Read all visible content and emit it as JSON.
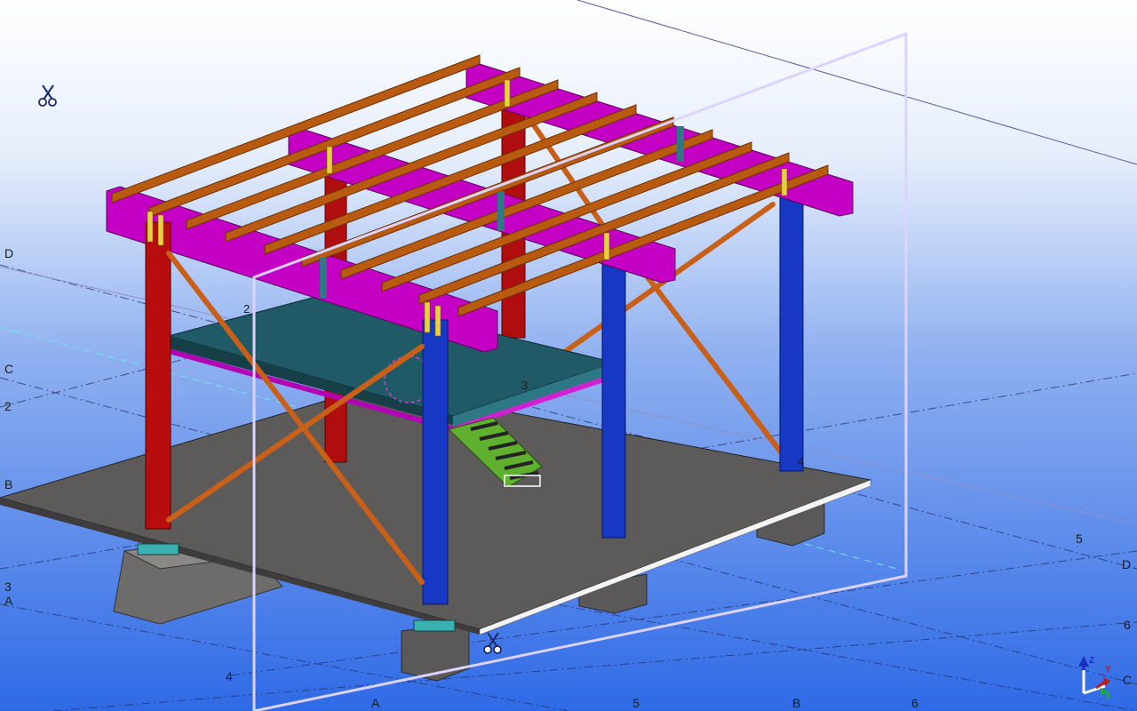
{
  "grid_labels": {
    "D_left": "D",
    "C_left": "C",
    "n2_left": "2",
    "B_left": "B",
    "n3_left": "3",
    "A_left": "A",
    "n4_bottom": "4",
    "A_bottom": "A",
    "n5_bottom": "5",
    "B_bottom": "B",
    "n6_bottom": "6",
    "n5_right": "5",
    "D_right": "D",
    "n6_right": "6",
    "C_right": "C"
  },
  "part_labels": {
    "p2": "2",
    "p3": "3",
    "p4": "4"
  },
  "axis_labels": {
    "z": "Z",
    "y": "Y",
    "x": "X"
  },
  "colors": {
    "background_top": "#ffffff",
    "background_bottom": "#2f6ae6",
    "beam_magenta": "#c400c4",
    "purlin_orange": "#b85a10",
    "column_red": "#b80d0d",
    "column_blue": "#1438c8",
    "bracing_orange": "#c8601a",
    "platform_teal": "#1f5a66",
    "floor_slab": "#5d5a5a",
    "footing": "#6a6868",
    "stair_green": "#5aa82a",
    "clip_plane": "#d8d0ff"
  },
  "icons": [
    "clip-plane-scissors-icon",
    "clip-plane-scissors-icon",
    "coordinate-axes-icon"
  ]
}
